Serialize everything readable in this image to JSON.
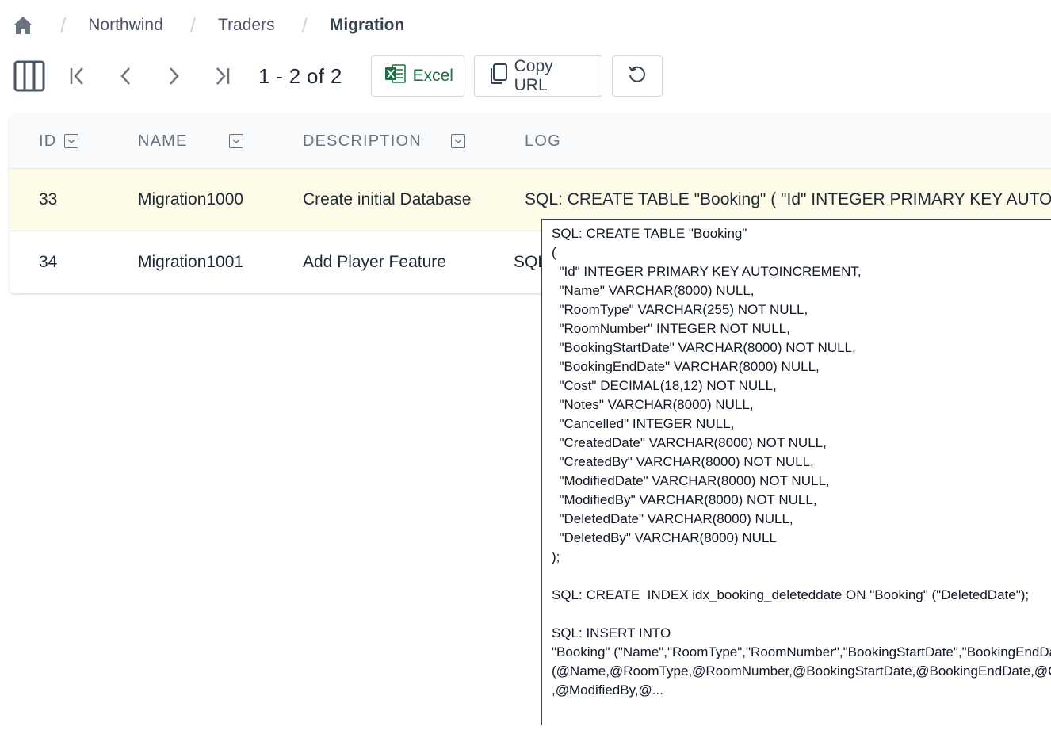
{
  "breadcrumb": {
    "home_icon": "home-icon",
    "items": [
      "Northwind",
      "Traders",
      "Migration"
    ]
  },
  "toolbar": {
    "page_info": "1 - 2 of 2",
    "excel_label": "Excel",
    "copy_url_label": "Copy URL"
  },
  "table": {
    "headers": {
      "id": "ID",
      "name": "NAME",
      "description": "DESCRIPTION",
      "log": "LOG"
    },
    "rows": [
      {
        "id": "33",
        "name": "Migration1000",
        "description": "Create initial Database",
        "log": "SQL: CREATE TABLE \"Booking\" ( \"Id\" INTEGER PRIMARY KEY AUTOINCREMENT,"
      },
      {
        "id": "34",
        "name": "Migration1001",
        "description": "Add Player Feature",
        "log": "SQL: CREATE TABLE"
      }
    ]
  },
  "tooltip": {
    "text": "SQL: CREATE TABLE \"Booking\"\n(\n  \"Id\" INTEGER PRIMARY KEY AUTOINCREMENT,\n  \"Name\" VARCHAR(8000) NULL,\n  \"RoomType\" VARCHAR(255) NOT NULL,\n  \"RoomNumber\" INTEGER NOT NULL,\n  \"BookingStartDate\" VARCHAR(8000) NOT NULL,\n  \"BookingEndDate\" VARCHAR(8000) NULL,\n  \"Cost\" DECIMAL(18,12) NOT NULL,\n  \"Notes\" VARCHAR(8000) NULL,\n  \"Cancelled\" INTEGER NULL,\n  \"CreatedDate\" VARCHAR(8000) NOT NULL,\n  \"CreatedBy\" VARCHAR(8000) NOT NULL,\n  \"ModifiedDate\" VARCHAR(8000) NOT NULL,\n  \"ModifiedBy\" VARCHAR(8000) NOT NULL,\n  \"DeletedDate\" VARCHAR(8000) NULL,\n  \"DeletedBy\" VARCHAR(8000) NULL\n);\n\nSQL: CREATE  INDEX idx_booking_deleteddate ON \"Booking\" (\"DeletedDate\");\n\nSQL: INSERT INTO\n\"Booking\" (\"Name\",\"RoomType\",\"RoomNumber\",\"BookingStartDate\",\"BookingEndDate\",\"Cost\",\"Notes\",\"Cancelled\",\"CreatedDate\",\"CreatedBy\",\"ModifiedDate\",\"ModifiedBy\",\"DeletedDate\",\"DeletedBy\") VALUES\n(@Name,@RoomType,@RoomNumber,@BookingStartDate,@BookingEndDate,@Cost\n,@ModifiedBy,@..."
  },
  "colors": {
    "highlight_row": "#fefce8",
    "header_bg": "#f9fafb",
    "excel_green": "#1d6f42"
  }
}
